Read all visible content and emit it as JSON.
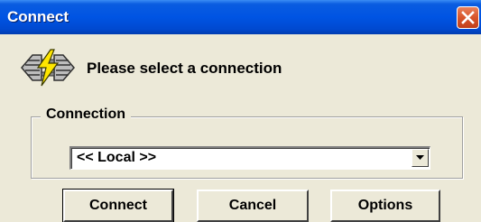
{
  "window": {
    "title": "Connect",
    "close_icon": "close-icon"
  },
  "header": {
    "icon": "connection-plug-icon",
    "prompt": "Please select a connection"
  },
  "connection_group": {
    "label": "Connection",
    "selected_value": "<< Local >>",
    "dropdown_icon": "chevron-down-icon"
  },
  "buttons": {
    "connect": "Connect",
    "cancel": "Cancel",
    "options": "Options"
  },
  "colors": {
    "titlebar": "#0054e3",
    "close_button": "#d8552b",
    "dialog_background": "#ece9d8"
  }
}
